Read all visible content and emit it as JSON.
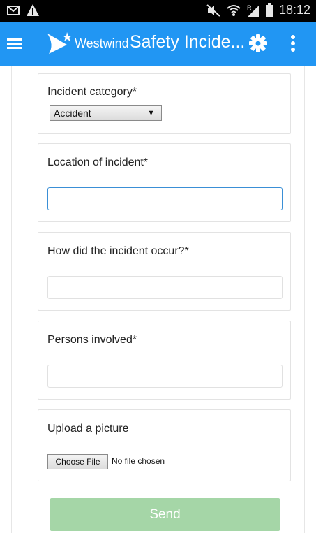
{
  "status_bar": {
    "time": "18:12",
    "icons": [
      "mail-icon",
      "warning-icon",
      "mute-icon",
      "wifi-icon",
      "signal-icon",
      "battery-icon"
    ]
  },
  "app_bar": {
    "brand": "Westwind",
    "title": "Safety Incide...",
    "color": "#2196f3"
  },
  "form": {
    "category": {
      "label": "Incident category*",
      "selected": "Accident"
    },
    "location": {
      "label": "Location of incident*",
      "value": ""
    },
    "occurrence": {
      "label": "How did the incident occur?*",
      "value": ""
    },
    "persons": {
      "label": "Persons involved*",
      "value": ""
    },
    "upload": {
      "label": "Upload a picture",
      "button": "Choose File",
      "status": "No file chosen"
    },
    "send_label": "Send",
    "send_color": "#a5d6a7"
  }
}
